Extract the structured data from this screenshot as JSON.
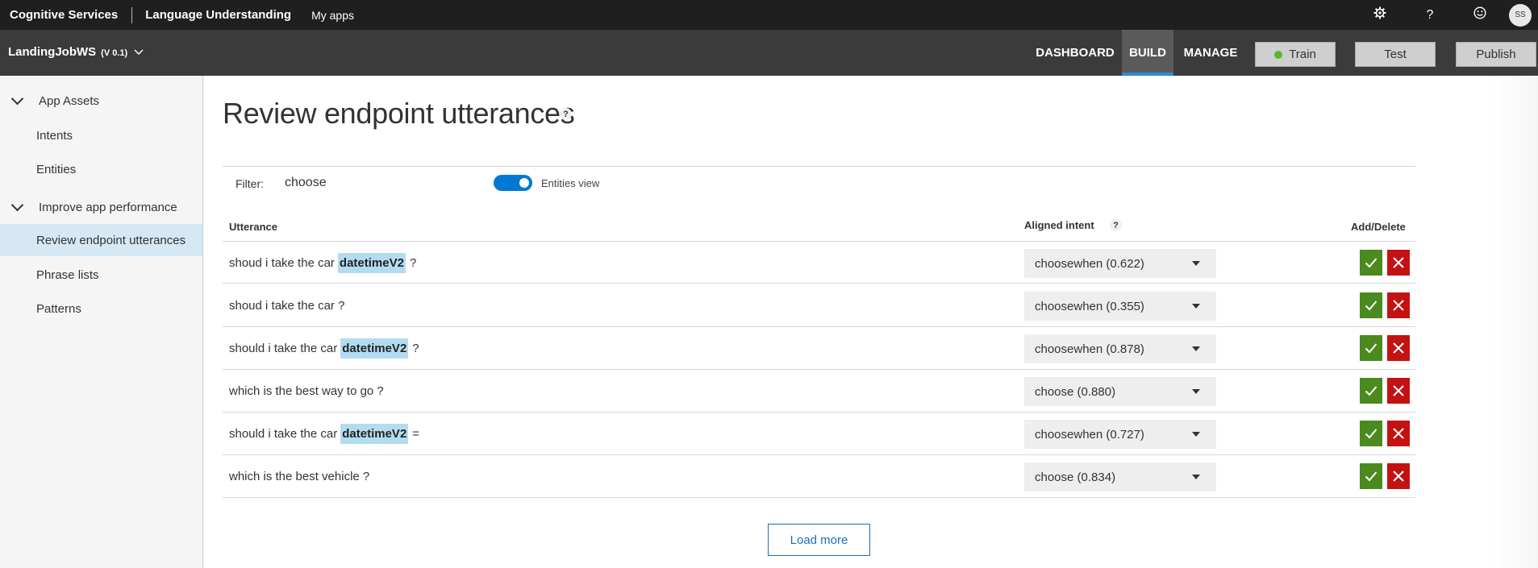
{
  "topbar": {
    "brand": "Cognitive Services",
    "product": "Language Understanding",
    "my_apps": "My apps",
    "icons": [
      "gear-icon",
      "help-icon",
      "smiley-icon"
    ],
    "avatar_initials": "SS"
  },
  "appbar": {
    "app_name": "LandingJobWS",
    "version": "(V 0.1)",
    "tabs": [
      "DASHBOARD",
      "BUILD",
      "MANAGE"
    ],
    "active_tab": "BUILD",
    "train_label": "Train",
    "test_label": "Test",
    "publish_label": "Publish"
  },
  "sidebar": {
    "sections": [
      {
        "label": "App Assets",
        "items": [
          "Intents",
          "Entities"
        ]
      },
      {
        "label": "Improve app performance",
        "items": [
          "Review endpoint utterances",
          "Phrase lists",
          "Patterns"
        ]
      }
    ],
    "selected": "Review endpoint utterances"
  },
  "main": {
    "title": "Review endpoint utterances",
    "help": "?",
    "filter_label": "Filter:",
    "filter_value": "choose",
    "entities_view_label": "Entities view",
    "entities_view_on": true,
    "columns": {
      "utterance": "Utterance",
      "aligned_intent": "Aligned intent",
      "add_delete": "Add/Delete"
    },
    "rows": [
      {
        "before": "shoud i take the car",
        "entity": "datetimeV2",
        "after": "?",
        "intent": "choosewhen (0.622)"
      },
      {
        "before": "shoud i take the car ?",
        "entity": "",
        "after": "",
        "intent": "choosewhen (0.355)"
      },
      {
        "before": "should i take the car",
        "entity": "datetimeV2",
        "after": "?",
        "intent": "choosewhen (0.878)"
      },
      {
        "before": "which is the best way to go ?",
        "entity": "",
        "after": "",
        "intent": "choose (0.880)"
      },
      {
        "before": "should i take the car",
        "entity": "datetimeV2",
        "after": "=",
        "intent": "choosewhen (0.727)"
      },
      {
        "before": "which is the best vehicle ?",
        "entity": "",
        "after": "",
        "intent": "choose (0.834)"
      }
    ],
    "load_more": "Load more"
  },
  "colors": {
    "accent": "#0078d4",
    "add": "#4a8a1f",
    "delete": "#c41111",
    "entity_highlight": "#b4dcf0"
  }
}
